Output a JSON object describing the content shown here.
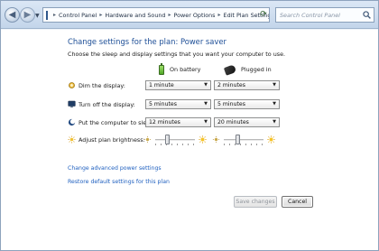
{
  "address_bar": {
    "breadcrumb": [
      "Control Panel",
      "Hardware and Sound",
      "Power Options",
      "Edit Plan Settings"
    ],
    "search_placeholder": "Search Control Panel"
  },
  "page": {
    "title": "Change settings for the plan: Power saver",
    "subtitle": "Choose the sleep and display settings that you want your computer to use."
  },
  "columns": {
    "battery": "On battery",
    "plugged": "Plugged in"
  },
  "settings": [
    {
      "label": "Dim the display:",
      "battery": "1 minute",
      "plugged": "2 minutes",
      "icon": "display-dim-icon"
    },
    {
      "label": "Turn off the display:",
      "battery": "5 minutes",
      "plugged": "5 minutes",
      "icon": "display-off-icon"
    },
    {
      "label": "Put the computer to sleep:",
      "battery": "12 minutes",
      "plugged": "20 minutes",
      "icon": "sleep-moon-icon"
    }
  ],
  "brightness": {
    "label": "Adjust plan brightness:",
    "battery_level": 0.3,
    "plugged_level": 0.35
  },
  "links": {
    "advanced": "Change advanced power settings",
    "restore": "Restore default settings for this plan"
  },
  "buttons": {
    "save": "Save changes",
    "cancel": "Cancel"
  },
  "colors": {
    "link": "#1e5fbf",
    "title": "#1e4f97"
  }
}
